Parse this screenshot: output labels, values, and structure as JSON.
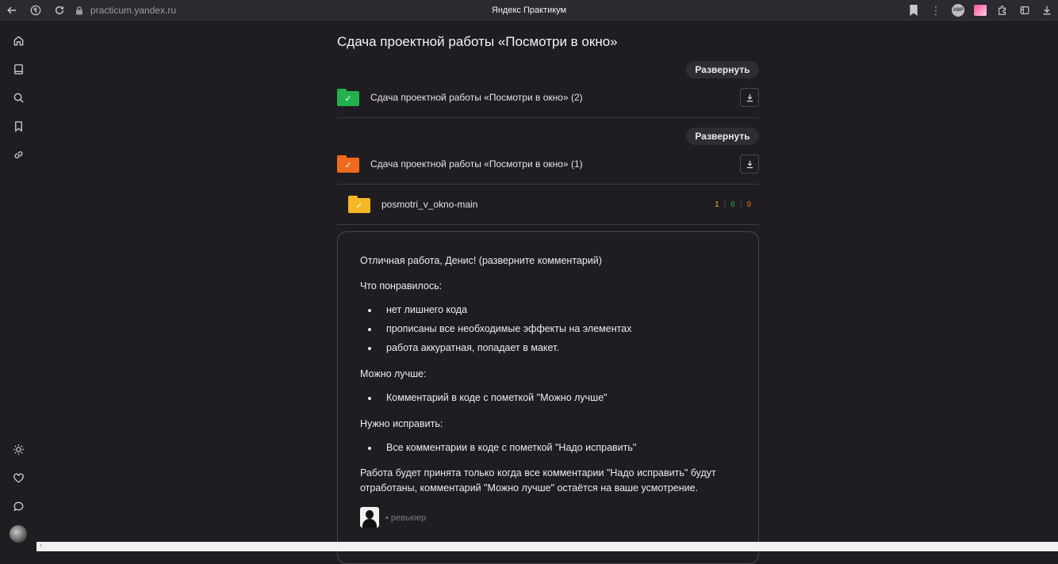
{
  "browser": {
    "url": "practicum.yandex.ru",
    "tab_title": "Яндекс Практикум",
    "ext_avatar_text": "ABP"
  },
  "page": {
    "title": "Сдача проектной работы «Посмотри в окно»"
  },
  "submissions": [
    {
      "expand_label": "Развернуть",
      "label": "Сдача проектной работы «Посмотри в окно» (2)",
      "status_color": "#22b14c"
    },
    {
      "expand_label": "Развернуть",
      "label": "Сдача проектной работы «Посмотри в окно» (1)",
      "status_color": "#f06a1d"
    }
  ],
  "repo": {
    "name": "posmotri_v_okno-main",
    "stats": [
      {
        "value": "1",
        "color": "#f5b722"
      },
      {
        "value": "6",
        "color": "#22b14c"
      },
      {
        "value": "9",
        "color": "#f06a1d"
      }
    ]
  },
  "comment": {
    "intro": "Отличная работа, Денис! (разверните комментарий)",
    "liked_heading": "Что понравилось:",
    "liked_items": [
      "нет лишнего кода",
      "прописаны все необходимые эффекты на элементах",
      "работа аккуратная, попадает в макет."
    ],
    "better_heading": "Можно лучше:",
    "better_items": [
      "Комментарий в коде с пометкой \"Можно лучше\""
    ],
    "fix_heading": "Нужно исправить:",
    "fix_items": [
      "Все комментарии в коде с пометкой \"Надо исправить\""
    ],
    "conclusion": "Работа будет принята только когда все комментарии \"Надо исправить\" будут отработаны, комментарий \"Можно лучше\" остаётся на ваше усмотрение.",
    "reviewer_label": "• ревьюер"
  },
  "bottom_strip_glyph": "‹"
}
